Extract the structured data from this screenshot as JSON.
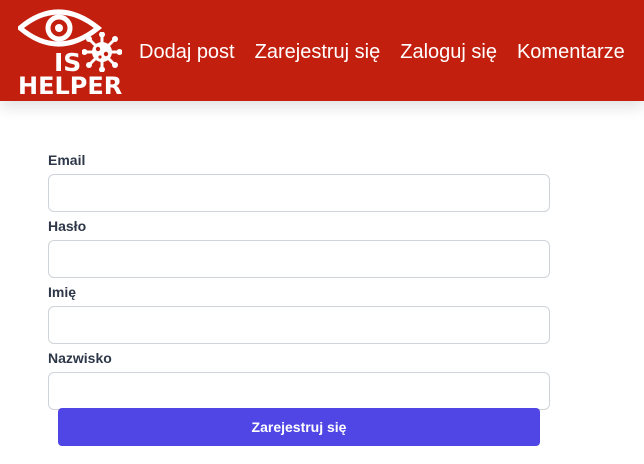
{
  "logo": {
    "text_top": "IS",
    "text_bottom": "HELPER",
    "icons": [
      "eye-icon",
      "virus-icon"
    ]
  },
  "nav": {
    "items": [
      {
        "label": "Dodaj post"
      },
      {
        "label": "Zarejestruj się"
      },
      {
        "label": "Zaloguj się"
      },
      {
        "label": "Komentarze"
      }
    ]
  },
  "form": {
    "fields": [
      {
        "label": "Email",
        "value": "",
        "placeholder": ""
      },
      {
        "label": "Hasło",
        "value": "",
        "placeholder": ""
      },
      {
        "label": "Imię",
        "value": "",
        "placeholder": ""
      },
      {
        "label": "Nazwisko",
        "value": "",
        "placeholder": ""
      }
    ],
    "submit_label": "Zarejestruj się"
  },
  "colors": {
    "navbar": "#c21f0f",
    "accent": "#4f46e5",
    "label": "#2d3748"
  }
}
